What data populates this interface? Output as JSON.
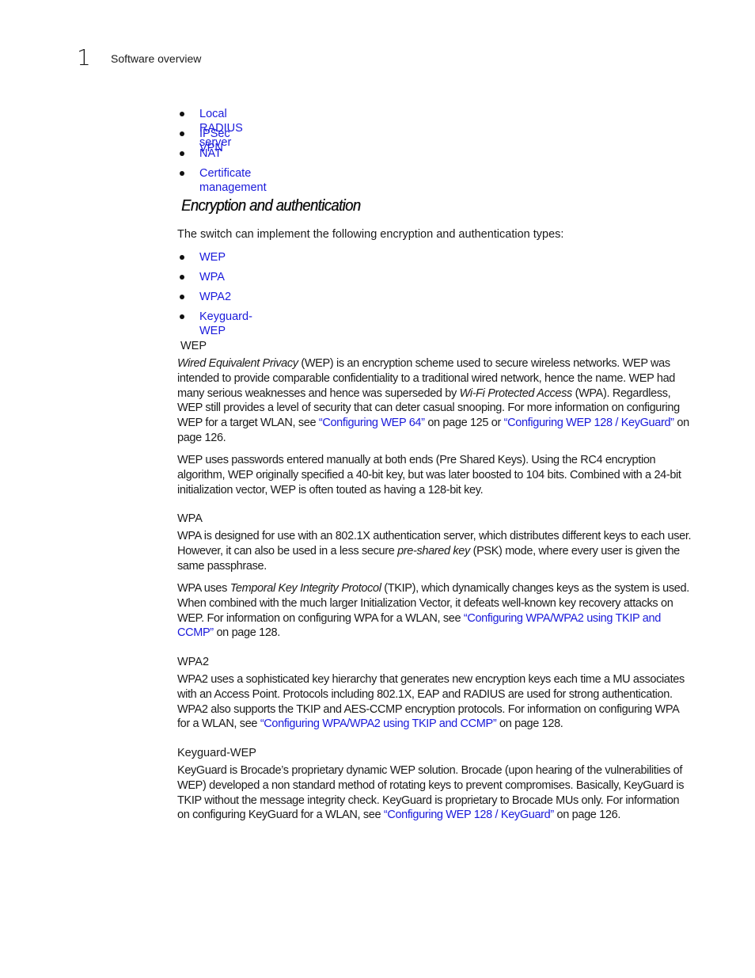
{
  "header": {
    "chapter_number": "1",
    "chapter_title": "Software overview"
  },
  "feature_list": [
    {
      "label": "Local RADIUS server"
    },
    {
      "label": "IPSec VPN"
    },
    {
      "label": "NAT"
    },
    {
      "label": "Certificate management"
    }
  ],
  "section": {
    "title": "Encryption and authentication",
    "intro": "The switch can implement the following encryption and authentication types:",
    "types": [
      {
        "label": "WEP"
      },
      {
        "label": "WPA"
      },
      {
        "label": "WPA2"
      },
      {
        "label": "Keyguard-WEP"
      }
    ]
  },
  "wep": {
    "heading": "WEP",
    "p1": {
      "t1_italic": "Wired Equivalent Privacy",
      "t2": " (WEP) is an encryption scheme used to secure wireless networks. WEP was intended to provide comparable confidentiality to a traditional wired network, hence the name. WEP had many serious weaknesses and hence was superseded by ",
      "t3_italic": "Wi-Fi Protected Access",
      "t4": " (WPA). Regardless, WEP still provides a level of security that can deter casual snooping. For more information on configuring WEP for a target WLAN, see ",
      "link1": "“Configuring WEP 64”",
      "t5": " on page 125 or ",
      "link2": "“Configuring WEP 128 / KeyGuard”",
      "t6": " on page 126."
    },
    "p2": "WEP uses passwords entered manually at both ends (Pre Shared Keys). Using the RC4 encryption algorithm, WEP originally specified a 40-bit key, but was later boosted to 104 bits. Combined with a 24-bit initialization vector, WEP is often touted as having a 128-bit key."
  },
  "wpa": {
    "heading": "WPA",
    "p1": {
      "t1": "WPA is designed for use with an 802.1X authentication server, which distributes different keys to each user. However, it can also be used in a less secure ",
      "t2_italic": "pre-shared key",
      "t3": " (PSK) mode, where every user is given the same passphrase."
    },
    "p2": {
      "t1": "WPA uses ",
      "t2_italic": "Temporal Key Integrity Protocol",
      "t3": " (TKIP), which dynamically changes keys as the system is used. When combined with the much larger Initialization Vector, it defeats well-known key recovery attacks on WEP. For information on configuring WPA for a WLAN, see ",
      "link": "“Configuring WPA/WPA2 using TKIP and CCMP”",
      "t4": " on page 128."
    }
  },
  "wpa2": {
    "heading": "WPA2",
    "p1": {
      "t1": "WPA2 uses a sophisticated key hierarchy that generates new encryption keys each time a MU associates with an Access Point. Protocols including 802.1X, EAP and RADIUS are used for strong authentication. WPA2 also supports the TKIP and AES-CCMP encryption protocols. For information on configuring WPA for a WLAN, see ",
      "link": "“Configuring WPA/WPA2 using TKIP and CCMP”",
      "t2": " on page 128."
    }
  },
  "keyguard": {
    "heading": "Keyguard-WEP",
    "p1": {
      "t1": "KeyGuard is Brocade’s proprietary dynamic WEP solution. Brocade (upon hearing of the vulnerabilities of WEP) developed a non standard method of rotating keys to prevent compromises. Basically, KeyGuard is TKIP without the message integrity check. KeyGuard is proprietary to Brocade MUs only. For information on configuring KeyGuard for a WLAN, see ",
      "link": "“Configuring WEP 128 / KeyGuard”",
      "t2": " on page 126."
    }
  }
}
